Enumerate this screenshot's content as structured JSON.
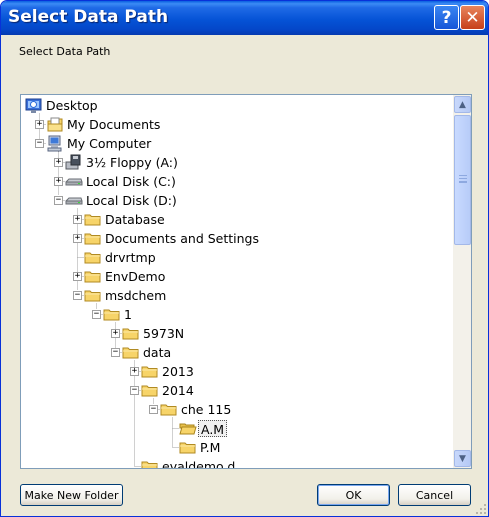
{
  "window": {
    "title": "Select Data Path",
    "help_glyph": "?",
    "close_glyph": "✕",
    "description": "Select Data Path"
  },
  "tree": {
    "items": [
      {
        "label": "Desktop",
        "icon": "desktop-icon",
        "depth": 0,
        "expander": "none"
      },
      {
        "label": "My Documents",
        "icon": "my-documents-icon",
        "depth": 1,
        "expander": "+"
      },
      {
        "label": "My Computer",
        "icon": "my-computer-icon",
        "depth": 1,
        "expander": "-"
      },
      {
        "label": "3½ Floppy (A:)",
        "icon": "floppy-icon",
        "depth": 2,
        "expander": "+"
      },
      {
        "label": "Local Disk (C:)",
        "icon": "drive-icon",
        "depth": 2,
        "expander": "+"
      },
      {
        "label": "Local Disk (D:)",
        "icon": "drive-icon",
        "depth": 2,
        "expander": "-"
      },
      {
        "label": "Database",
        "icon": "folder-icon",
        "depth": 3,
        "expander": "+"
      },
      {
        "label": "Documents and Settings",
        "icon": "folder-icon",
        "depth": 3,
        "expander": "+"
      },
      {
        "label": "drvrtmp",
        "icon": "folder-icon",
        "depth": 3,
        "expander": "none"
      },
      {
        "label": "EnvDemo",
        "icon": "folder-icon",
        "depth": 3,
        "expander": "+"
      },
      {
        "label": "msdchem",
        "icon": "folder-icon",
        "depth": 3,
        "expander": "-"
      },
      {
        "label": "1",
        "icon": "folder-icon",
        "depth": 4,
        "expander": "-"
      },
      {
        "label": "5973N",
        "icon": "folder-icon",
        "depth": 5,
        "expander": "+"
      },
      {
        "label": "data",
        "icon": "folder-icon",
        "depth": 5,
        "expander": "-"
      },
      {
        "label": "2013",
        "icon": "folder-icon",
        "depth": 6,
        "expander": "+"
      },
      {
        "label": "2014",
        "icon": "folder-icon",
        "depth": 6,
        "expander": "-"
      },
      {
        "label": "che 115",
        "icon": "folder-icon",
        "depth": 7,
        "expander": "-"
      },
      {
        "label": "A.M",
        "icon": "folder-open-icon",
        "depth": 8,
        "expander": "none",
        "selected": true
      },
      {
        "label": "P.M",
        "icon": "folder-icon",
        "depth": 8,
        "expander": "none"
      },
      {
        "label": "evaldemo.d",
        "icon": "folder-icon",
        "depth": 6,
        "expander": "none"
      }
    ]
  },
  "scrollbar": {
    "up_glyph": "▲",
    "down_glyph": "▼"
  },
  "buttons": {
    "new_folder": "Make New Folder",
    "ok": "OK",
    "cancel": "Cancel"
  },
  "colors": {
    "titlebar": "#0553d6",
    "dialog_bg": "#ece9d8",
    "folder": "#f7d469",
    "tree_border": "#7f9db9"
  }
}
